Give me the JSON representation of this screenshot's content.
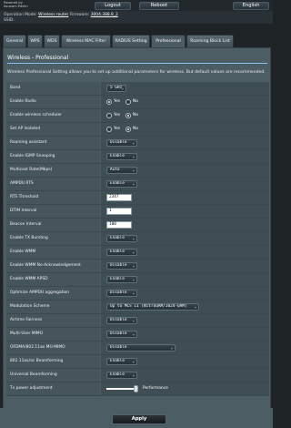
{
  "header": {
    "powered_by_line1": "Powered by",
    "powered_by_line2": "Asuswrt-Merlin",
    "logout_label": "Logout",
    "reboot_label": "Reboot",
    "language_label": "English",
    "operation_mode_label": "Operation Mode:",
    "operation_mode_value": "Wireless router",
    "firmware_label": "Firmware:",
    "firmware_value": "3004.388.8_2",
    "ssid_label": "SSID:"
  },
  "tabs": [
    {
      "label": "General"
    },
    {
      "label": "WPS"
    },
    {
      "label": "WDS"
    },
    {
      "label": "Wireless MAC Filter"
    },
    {
      "label": "RADIUS Setting"
    },
    {
      "label": "Professional"
    },
    {
      "label": "Roaming Block List"
    }
  ],
  "panel": {
    "title": "Wireless - Professional",
    "description": "Wireless Professional Setting allows you to set up additional parameters for wireless. But default values are recommended."
  },
  "settings": [
    {
      "label": "Band",
      "value": "5 GHz"
    },
    {
      "label": "Enable Radio",
      "yes": "Yes",
      "no": "No"
    },
    {
      "label": "Enable wireless scheduler",
      "yes": "Yes",
      "no": "No"
    },
    {
      "label": "Set AP Isolated",
      "yes": "Yes",
      "no": "No"
    },
    {
      "label": "Roaming assistant",
      "value": "Disable"
    },
    {
      "label": "Enable IGMP Snooping",
      "value": "Enable"
    },
    {
      "label": "Multicast Rate(Mbps)",
      "value": "Auto"
    },
    {
      "label": "AMPDU RTS",
      "value": "Enable"
    },
    {
      "label": "RTS Threshold",
      "value": "2347"
    },
    {
      "label": "DTIM Interval",
      "value": "1"
    },
    {
      "label": "Beacon Interval",
      "value": "100"
    },
    {
      "label": "Enable TX Bursting",
      "value": "Enable"
    },
    {
      "label": "Enable WMM",
      "value": "Enable"
    },
    {
      "label": "Enable WMM No-Acknowledgement",
      "value": "Disable"
    },
    {
      "label": "Enable WMM APSD",
      "value": "Enable"
    },
    {
      "label": "Optimize AMPDU aggregation",
      "value": "Disable"
    },
    {
      "label": "Modulation Scheme",
      "value": "Up to MCS 11 (NitroQAM/1024-QAM)"
    },
    {
      "label": "Airtime Fairness",
      "value": "Disable"
    },
    {
      "label": "Multi-User MIMO",
      "value": "Disable"
    },
    {
      "label": "OFDMA/802.11ax MU-MIMO",
      "value": "Disable"
    },
    {
      "label": "802.11ax/ac Beamforming",
      "value": "Enable"
    },
    {
      "label": "Universal Beamforming",
      "value": "Enable"
    },
    {
      "label": "Tx power adjustment",
      "value": "Performance",
      "level": 0.95
    }
  ],
  "apply_label": "Apply",
  "icons": {
    "dropdown": "chevron-down-icon"
  },
  "colors": {
    "background": "#1e2326",
    "panel": "#4d5d64",
    "rule": "#86c0ef"
  }
}
